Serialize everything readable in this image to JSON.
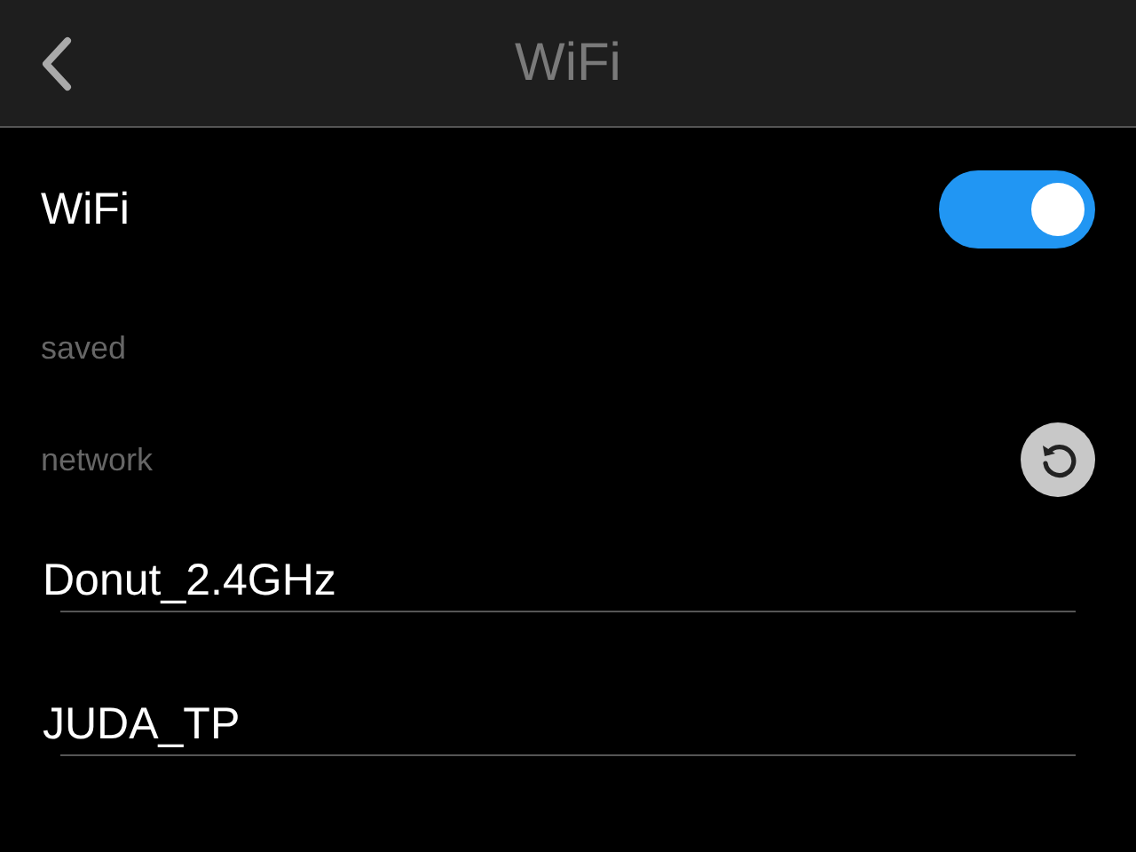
{
  "header": {
    "title": "WiFi"
  },
  "wifi": {
    "label": "WiFi",
    "on": true
  },
  "sections": [
    {
      "label": "saved"
    },
    {
      "label": "network"
    }
  ],
  "networks": [
    {
      "name": "Donut_2.4GHz"
    },
    {
      "name": "JUDA_TP"
    }
  ]
}
